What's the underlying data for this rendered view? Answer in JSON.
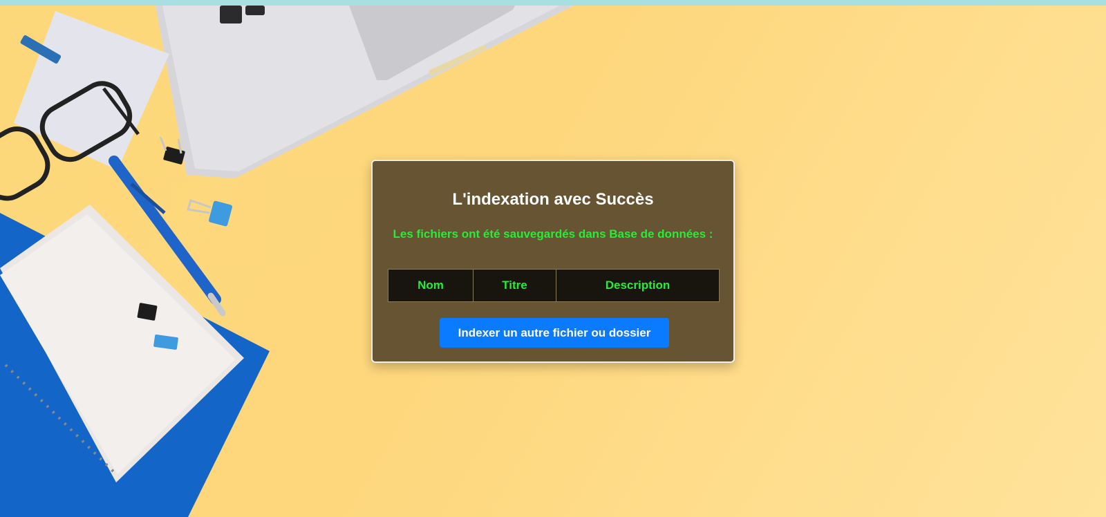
{
  "card": {
    "title": "L'indexation avec Succès",
    "subtitle": "Les fichiers ont été sauvegardés dans Base de données :",
    "table": {
      "columns": [
        "Nom",
        "Titre",
        "Description"
      ]
    },
    "button_label": "Indexer un autre fichier ou dossier"
  },
  "colors": {
    "card_background": "#665432",
    "accent_green": "#23ef35",
    "button_blue": "#0a7bff",
    "page_background": "#fdd87a",
    "topbar": "#a8dfe0"
  },
  "background_image": {
    "objects": [
      "laptop",
      "eyeglasses",
      "pen",
      "binder-clips",
      "notebook",
      "sticky-note"
    ]
  }
}
